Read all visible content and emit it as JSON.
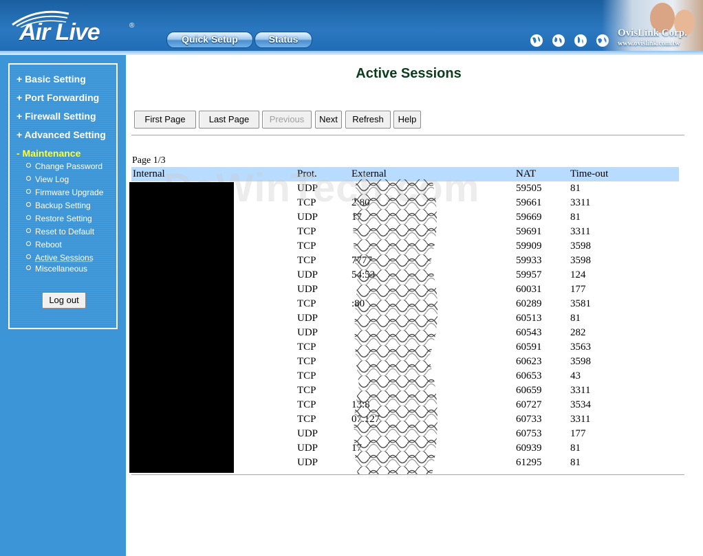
{
  "header": {
    "logo_text": "Air Live",
    "logo_mark": "®",
    "nav": [
      {
        "label": "Quick Setup"
      },
      {
        "label": "Status"
      }
    ],
    "brand_name": "OvisLink Corp.",
    "brand_url": "www.ovislink.com.tw",
    "globe_icons": [
      "globe-icon",
      "globe-icon",
      "globe-icon",
      "globe-icon"
    ]
  },
  "sidebar": {
    "menu": [
      {
        "label": "+ Basic Setting"
      },
      {
        "label": "+ Port Forwarding"
      },
      {
        "label": "+ Firewall Setting"
      },
      {
        "label": "+ Advanced Setting"
      },
      {
        "label": "- Maintenance"
      }
    ],
    "submenu": [
      {
        "label": "Change Password"
      },
      {
        "label": "View Log"
      },
      {
        "label": "Firmware Upgrade"
      },
      {
        "label": "Backup Setting"
      },
      {
        "label": "Restore Setting"
      },
      {
        "label": "Reset to Default"
      },
      {
        "label": "Reboot"
      },
      {
        "label": "Active Sessions"
      },
      {
        "label": "Miscellaneous"
      }
    ],
    "logout_label": "Log out"
  },
  "main": {
    "title": "Active Sessions",
    "buttons": {
      "first_page": "First Page",
      "last_page": "Last Page",
      "previous": "Previous",
      "next": "Next",
      "refresh": "Refresh",
      "help": "Help"
    },
    "page_info": "Page 1/3",
    "watermark": "DeWinTech.com",
    "columns": {
      "internal": "Internal",
      "prot": "Prot.",
      "external": "External",
      "nat": "NAT",
      "timeout": "Time-out"
    },
    "rows": [
      {
        "prot": "UDP",
        "external": "",
        "nat": "59505",
        "timeout": "81"
      },
      {
        "prot": "TCP",
        "external": "2:80",
        "nat": "59661",
        "timeout": "3311"
      },
      {
        "prot": "UDP",
        "external": "17",
        "nat": "59669",
        "timeout": "81"
      },
      {
        "prot": "TCP",
        "external": "",
        "nat": "59691",
        "timeout": "3311"
      },
      {
        "prot": "TCP",
        "external": "",
        "nat": "59909",
        "timeout": "3598"
      },
      {
        "prot": "TCP",
        "external": "7777",
        "nat": "59933",
        "timeout": "3598"
      },
      {
        "prot": "UDP",
        "external": "54:53",
        "nat": "59957",
        "timeout": "124"
      },
      {
        "prot": "UDP",
        "external": "",
        "nat": "60031",
        "timeout": "177"
      },
      {
        "prot": "TCP",
        "external": ":80",
        "nat": "60289",
        "timeout": "3581"
      },
      {
        "prot": "UDP",
        "external": "",
        "nat": "60513",
        "timeout": "81"
      },
      {
        "prot": "UDP",
        "external": "",
        "nat": "60543",
        "timeout": "282"
      },
      {
        "prot": "TCP",
        "external": "",
        "nat": "60591",
        "timeout": "3563"
      },
      {
        "prot": "TCP",
        "external": "",
        "nat": "60623",
        "timeout": "3598"
      },
      {
        "prot": "TCP",
        "external": "",
        "nat": "60653",
        "timeout": "43"
      },
      {
        "prot": "TCP",
        "external": "",
        "nat": "60659",
        "timeout": "3311"
      },
      {
        "prot": "TCP",
        "external": "13:8",
        "nat": "60727",
        "timeout": "3534"
      },
      {
        "prot": "TCP",
        "external": "07.127",
        "nat": "60733",
        "timeout": "3311"
      },
      {
        "prot": "UDP",
        "external": "",
        "nat": "60753",
        "timeout": "177"
      },
      {
        "prot": "UDP",
        "external": "17",
        "nat": "60939",
        "timeout": "81"
      },
      {
        "prot": "UDP",
        "external": "",
        "nat": "61295",
        "timeout": "81"
      }
    ]
  },
  "colors": {
    "header_blue": "#2b78c0",
    "sidebar_blue": "#3b95d6",
    "active_menu": "#ffff33",
    "table_header": "#b8dcff",
    "title_green": "#0b3d1a"
  }
}
